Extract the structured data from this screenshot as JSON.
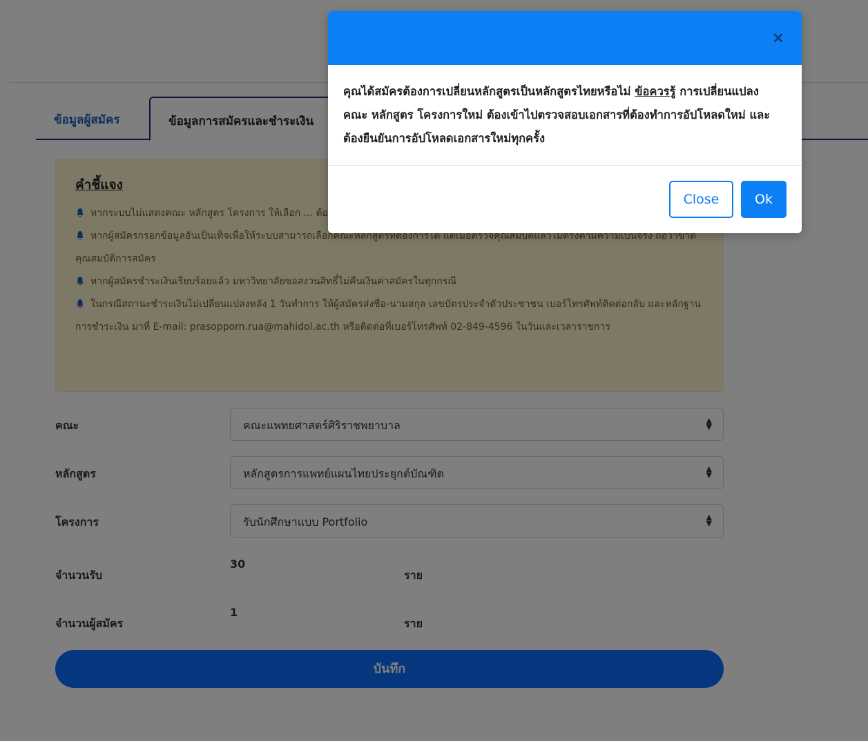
{
  "tabs": [
    {
      "label": "ข้อมูลผู้สมัคร"
    },
    {
      "label": "ข้อมูลการสมัครและชำระเงิน"
    }
  ],
  "notice": {
    "title": "คำชี้แจง",
    "items": [
      "หากระบบไม่แสดงคณะ หลักสูตร โครงการ ให้เลือก ... ต้อง ครบถ้วนตามเงื่อนไขการรับของหลักสูตรที่ต้องการสมัครเรียน",
      "หากผู้สมัครกรอกข้อมูลอันเป็นเท็จเพื่อให้ระบบสามารถเลือกคณะหลักสูตรที่ต้องการได้ แต่เมื่อตรวจคุณสมบัติแล้วไม่ตรงตามความเป็นจริง ถือว่าขาดคุณสมบัติการสมัคร",
      "หากผู้สมัครชำระเงินเรียบร้อยแล้ว มหาวิทยาลัยขอสงวนสิทธิ์ไม่คืนเงินค่าสมัครในทุกกรณี",
      "ในกรณีสถานะชำระเงินไม่เปลี่ยนแปลงหลัง 1 วันทำการ ให้ผู้สมัครส่งชื่อ-นามสกุล เลขบัตรประจำตัวประชาชน เบอร์โทรศัพท์ติดต่อกลับ และหลักฐานการชำระเงิน มาที่ E-mail: prasopporn.rua@mahidol.ac.th หรือติดต่อที่เบอร์โทรศัพท์ 02-849-4596 ในวันและเวลาราชการ"
    ]
  },
  "form": {
    "faculty_label": "คณะ",
    "faculty_value": "คณะแพทยศาสตร์ศิริราชพยาบาล",
    "program_label": "หลักสูตร",
    "program_value": "หลักสูตรการแพทย์แผนไทยประยุกต์บัณฑิต",
    "project_label": "โครงการ",
    "project_value": "รับนักศึกษาแบบ Portfolio",
    "quota_label": "จำนวนรับ",
    "quota_value": "30",
    "quota_unit": "ราย",
    "applicants_label": "จำนวนผู้สมัคร",
    "applicants_value": "1",
    "applicants_unit": "ราย",
    "save_label": "บันทึก"
  },
  "modal": {
    "close_icon": "×",
    "message_part1": "คุณได้สมัครต้องการเปลี่ยนหลักสูตรเป็นหลักสูตรไทยหรือไม่ ",
    "message_link": "ข้อควรรู้",
    "message_part2": " การเปลี่ยนแปลง คณะ หลักสูตร โครงการใหม่ ต้องเข้าไปตรวจสอบเอกสารที่ต้องทำการอัปโหลดใหม่ และต้องยืนยันการอัปโหลดเอกสารใหม่ทุกครั้ง",
    "close_button": "Close",
    "ok_button": "Ok"
  },
  "colors": {
    "primary": "#0d7ff5",
    "tab_border": "#26287a",
    "notice_bg": "#fdf3cf"
  }
}
